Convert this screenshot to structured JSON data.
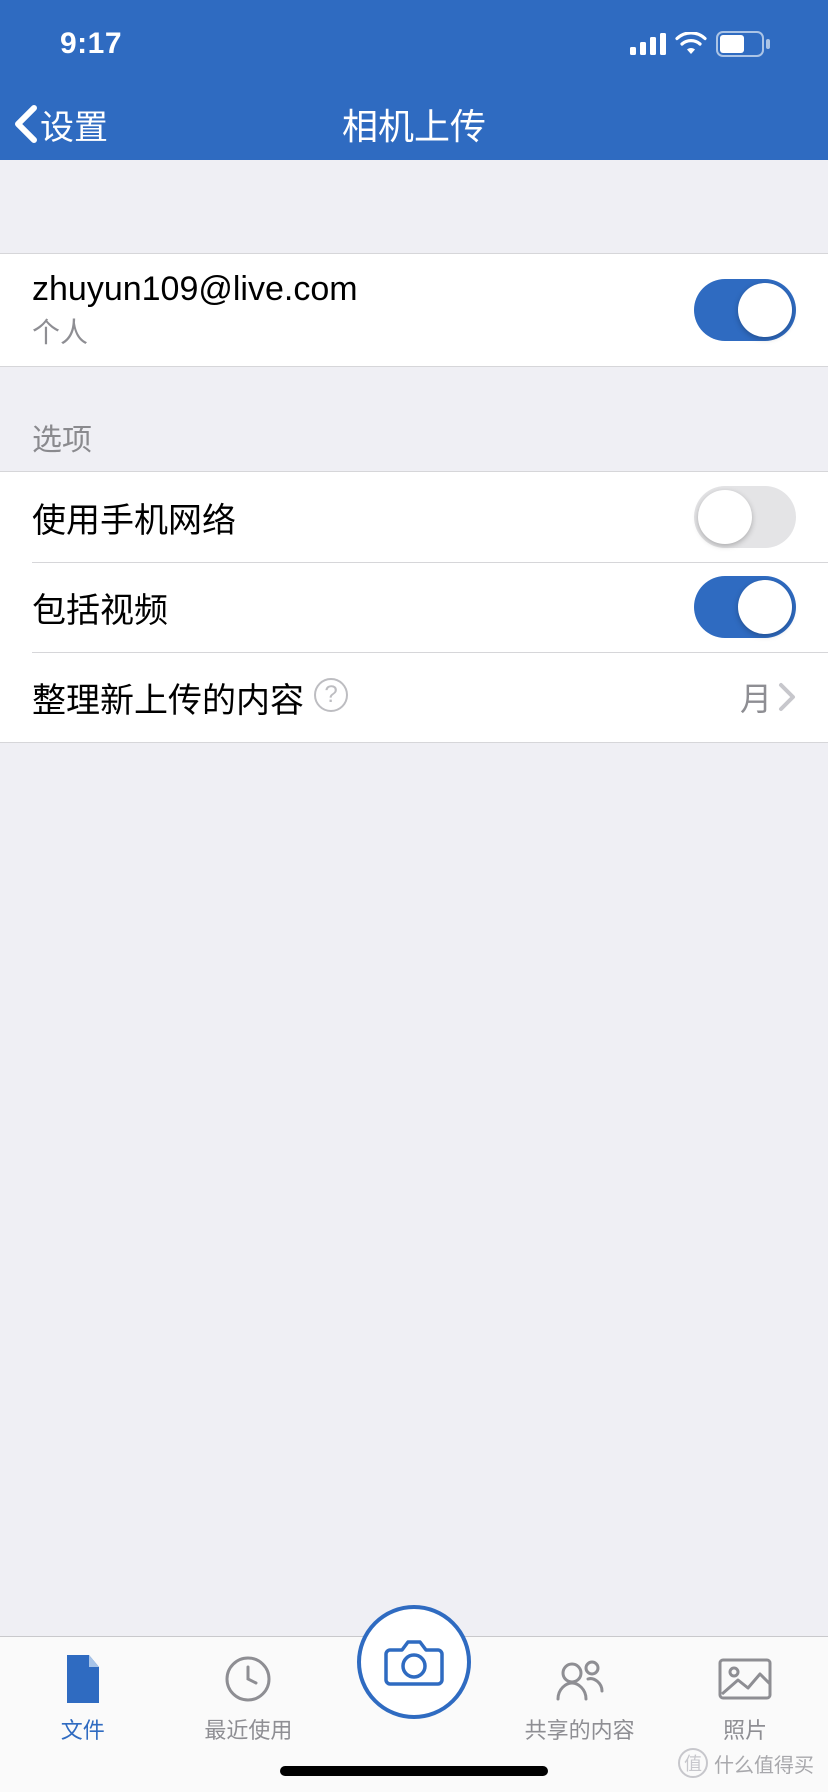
{
  "status": {
    "time": "9:17"
  },
  "nav": {
    "back_label": "设置",
    "title": "相机上传"
  },
  "account": {
    "email": "zhuyun109@live.com",
    "type_label": "个人",
    "toggle_on": true
  },
  "options": {
    "header": "选项",
    "cellular": {
      "label": "使用手机网络",
      "on": false
    },
    "include_video": {
      "label": "包括视频",
      "on": true
    },
    "organize": {
      "label": "整理新上传的内容",
      "value": "月"
    }
  },
  "tabs": {
    "files": "文件",
    "recent": "最近使用",
    "shared": "共享的内容",
    "photos": "照片"
  },
  "watermark": "什么值得买"
}
